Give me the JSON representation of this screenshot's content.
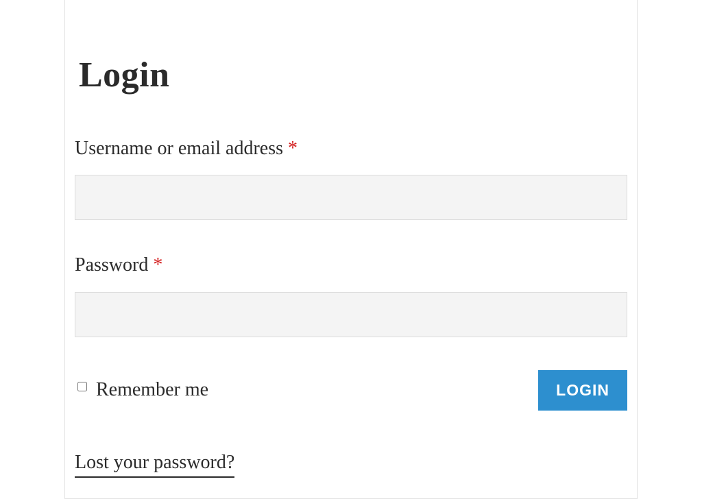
{
  "title": "Login",
  "fields": {
    "username": {
      "label": "Username or email address ",
      "required_mark": "*",
      "value": ""
    },
    "password": {
      "label": "Password ",
      "required_mark": "*",
      "value": ""
    }
  },
  "remember": {
    "label": "Remember me",
    "checked": false
  },
  "submit_label": "LOGIN",
  "lost_password_label": "Lost your password?"
}
